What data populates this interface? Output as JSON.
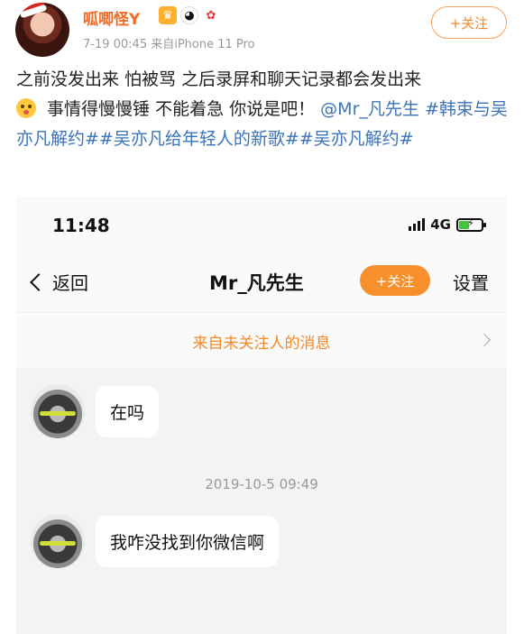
{
  "post": {
    "username": "呱唧怪Y",
    "meta": "7-19 00:45  来自iPhone 11 Pro",
    "follow_label": "+关注",
    "text_1": "之前没发出来 怕被骂 之后录屏和聊天记录都会发出来",
    "text_2": " 事情得慢慢锤 不能着急 你说是吧！",
    "mention": "@Mr_凡先生",
    "hashtags": "#韩束与吴亦凡解约##吴亦凡给年轻人的新歌##吴亦凡解约#",
    "badge_icons": [
      "crown-icon",
      "panda-icon",
      "gift-icon"
    ]
  },
  "screenshot": {
    "time": "11:48",
    "network": "4G",
    "back_label": "返回",
    "chat_title": "Mr_凡先生",
    "follow_label": "+关注",
    "settings_label": "设置",
    "stranger_banner": "来自未关注人的消息",
    "messages": [
      {
        "text": "在吗"
      },
      {
        "text": "我咋没找到你微信啊"
      }
    ],
    "timestamp": "2019-10-5 09:49"
  },
  "colors": {
    "accent_orange": "#f7902b",
    "username_orange": "#f26a25",
    "link_blue": "#3b73b9"
  }
}
